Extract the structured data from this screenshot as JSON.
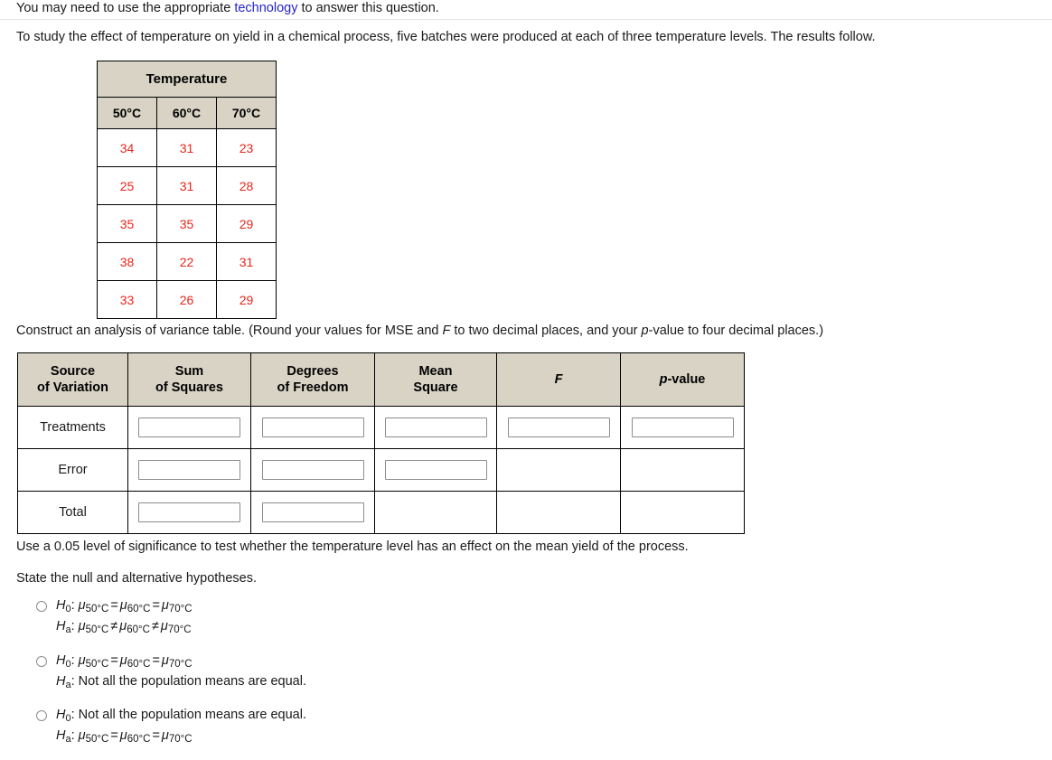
{
  "intro": {
    "line1_before": "You may need to use the appropriate ",
    "line1_link": "technology",
    "line1_after": " to answer this question.",
    "line2": "To study the effect of temperature on yield in a chemical process, five batches were produced at each of three temperature levels. The results follow."
  },
  "data_table": {
    "title": "Temperature",
    "columns": [
      "50°C",
      "60°C",
      "70°C"
    ],
    "rows": [
      [
        "34",
        "31",
        "23"
      ],
      [
        "25",
        "31",
        "28"
      ],
      [
        "35",
        "35",
        "29"
      ],
      [
        "38",
        "22",
        "31"
      ],
      [
        "33",
        "26",
        "29"
      ]
    ]
  },
  "instructions": {
    "anova_a": "Construct an analysis of variance table. (Round your values for MSE and ",
    "anova_f": "F",
    "anova_b": " to two decimal places, and your ",
    "anova_p": "p",
    "anova_c": "-value to four decimal places.)",
    "significance": "Use a 0.05 level of significance to test whether the temperature level has an effect on the mean yield of the process.",
    "state": "State the null and alternative hypotheses."
  },
  "anova_table": {
    "headers": [
      {
        "l1": "Source",
        "l2": "of Variation"
      },
      {
        "l1": "Sum",
        "l2": "of Squares"
      },
      {
        "l1": "Degrees",
        "l2": "of Freedom"
      },
      {
        "l1": "Mean",
        "l2": "Square"
      },
      {
        "l1": "F",
        "l2": ""
      },
      {
        "l1": "p-value",
        "l2": ""
      }
    ],
    "rows": [
      {
        "label": "Treatments",
        "inputs": [
          "",
          "",
          "",
          "",
          ""
        ],
        "input_count": 5
      },
      {
        "label": "Error",
        "inputs": [
          "",
          "",
          ""
        ],
        "input_count": 3
      },
      {
        "label": "Total",
        "inputs": [
          "",
          ""
        ],
        "input_count": 2
      }
    ],
    "input_placeholder": ""
  },
  "options": [
    {
      "id": "option-1",
      "null_label": "H",
      "null_sub": "0",
      "null_text": "mu_50 = mu_60 = mu_70",
      "alt_label": "H",
      "alt_sub": "a",
      "alt_text": "mu_50 ≠ mu_60 ≠ mu_70",
      "null_type": "mu",
      "alt_type": "mu",
      "null_ops": [
        "=",
        "="
      ],
      "alt_ops": [
        "≠",
        "≠"
      ],
      "selected": false
    },
    {
      "id": "option-2",
      "null_label": "H",
      "null_sub": "0",
      "null_type": "mu",
      "null_ops": [
        "=",
        "="
      ],
      "alt_label": "H",
      "alt_sub": "a",
      "alt_type": "text",
      "alt_text": "Not all the population means are equal.",
      "selected": false
    },
    {
      "id": "option-3",
      "null_label": "H",
      "null_sub": "0",
      "null_type": "text",
      "null_text": "Not all the population means are equal.",
      "alt_label": "H",
      "alt_sub": "a",
      "alt_type": "mu",
      "alt_ops": [
        "=",
        "="
      ],
      "selected": false
    }
  ],
  "mu_subscripts": [
    "50°C",
    "60°C",
    "70°C"
  ],
  "mu_symbol": "μ",
  "colors": {
    "header_bg": "#d8d3c4",
    "data_value": "#e8261b",
    "link": "#2525cc",
    "border": "#000000",
    "input_border": "#8c8c8c"
  }
}
